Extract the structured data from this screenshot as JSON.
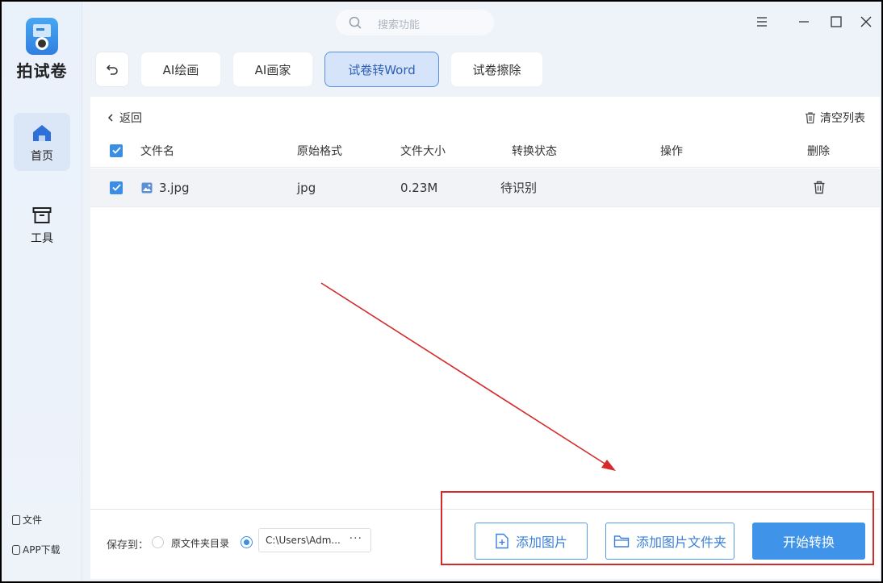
{
  "app": {
    "name": "拍试卷"
  },
  "sidebar": {
    "items": [
      {
        "label": "首页",
        "icon": "home-icon",
        "active": true
      },
      {
        "label": "工具",
        "icon": "toolbox-icon",
        "active": false
      }
    ],
    "bottom": [
      {
        "label": "文件",
        "icon": "file-icon"
      },
      {
        "label": "APP下载",
        "icon": "phone-icon"
      }
    ]
  },
  "search": {
    "placeholder": "搜索功能",
    "icon": "search-icon"
  },
  "tabs": [
    {
      "label": "AI绘画",
      "active": false
    },
    {
      "label": "AI画家",
      "active": false
    },
    {
      "label": "试卷转Word",
      "active": true
    },
    {
      "label": "试卷擦除",
      "active": false
    }
  ],
  "panel": {
    "back_label": "返回",
    "clear_label": "清空列表",
    "columns": [
      "文件名",
      "原始格式",
      "文件大小",
      "转换状态",
      "操作",
      "删除"
    ],
    "rows": [
      {
        "name": "3.jpg",
        "format": "jpg",
        "size": "0.23M",
        "status": "待识别",
        "checked": true
      }
    ]
  },
  "footer": {
    "save_to_label": "保存到：",
    "option_original": "原文件夹目录",
    "path_value": "C:\\Users\\Adm...",
    "path_more": "···",
    "add_image_label": "添加图片",
    "add_folder_label": "添加图片文件夹",
    "start_label": "开始转换"
  },
  "colors": {
    "accent": "#3f93e8",
    "annotation": "#d42a2a",
    "active_tab_bg": "#d6e4fa"
  }
}
